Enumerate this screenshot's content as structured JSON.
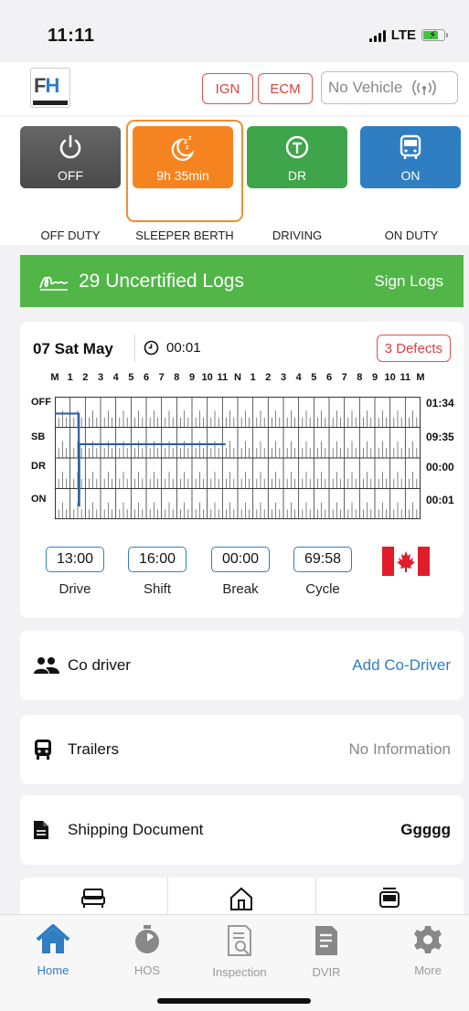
{
  "status_bar": {
    "time": "11:11",
    "network": "LTE"
  },
  "header": {
    "logo_text_f": "F",
    "logo_text_h": "H",
    "chips": {
      "ign": "IGN",
      "ecm": "ECM"
    },
    "vehicle": "No Vehicle"
  },
  "duty": [
    {
      "key": "off",
      "value": "OFF",
      "label": "OFF DUTY",
      "icon": "power-icon",
      "color": "#555555"
    },
    {
      "key": "sb",
      "value": "9h 35min",
      "label": "SLEEPER BERTH",
      "icon": "moon-sleep-icon",
      "color": "#f58420",
      "selected": true
    },
    {
      "key": "dr",
      "value": "DR",
      "label": "DRIVING",
      "icon": "steering-wheel-icon",
      "color": "#3ea54a"
    },
    {
      "key": "on",
      "value": "ON",
      "label": "ON DUTY",
      "icon": "bus-icon",
      "color": "#2f7ec2"
    }
  ],
  "uncertified": {
    "text": "29 Uncertified Logs",
    "action": "Sign Logs",
    "color": "#51b548"
  },
  "log": {
    "date": "07 Sat May",
    "time": "00:01",
    "defects": "3 Defects",
    "hour_labels": [
      "M",
      "1",
      "2",
      "3",
      "4",
      "5",
      "6",
      "7",
      "8",
      "9",
      "10",
      "11",
      "N",
      "1",
      "2",
      "3",
      "4",
      "5",
      "6",
      "7",
      "8",
      "9",
      "10",
      "11",
      "M"
    ],
    "rows": [
      {
        "label": "OFF",
        "total": "01:34"
      },
      {
        "label": "SB",
        "total": "09:35"
      },
      {
        "label": "DR",
        "total": "00:00"
      },
      {
        "label": "ON",
        "total": "00:01"
      }
    ],
    "counters": [
      {
        "value": "13:00",
        "label": "Drive"
      },
      {
        "value": "16:00",
        "label": "Shift"
      },
      {
        "value": "00:00",
        "label": "Break"
      },
      {
        "value": "69:58",
        "label": "Cycle"
      }
    ],
    "country_flag": "canada-flag-icon"
  },
  "co_driver": {
    "title": "Co driver",
    "action": "Add Co-Driver"
  },
  "trailers": {
    "title": "Trailers",
    "value": "No Information"
  },
  "shipping": {
    "title": "Shipping Document",
    "value": "Ggggg"
  },
  "tabs": [
    {
      "label": "Home",
      "icon": "home-icon",
      "active": true
    },
    {
      "label": "HOS",
      "icon": "stopwatch-icon"
    },
    {
      "label": "Inspection",
      "icon": "inspection-doc-icon"
    },
    {
      "label": "DVIR",
      "icon": "dvir-doc-icon"
    },
    {
      "label": "More",
      "icon": "gear-icon"
    }
  ]
}
